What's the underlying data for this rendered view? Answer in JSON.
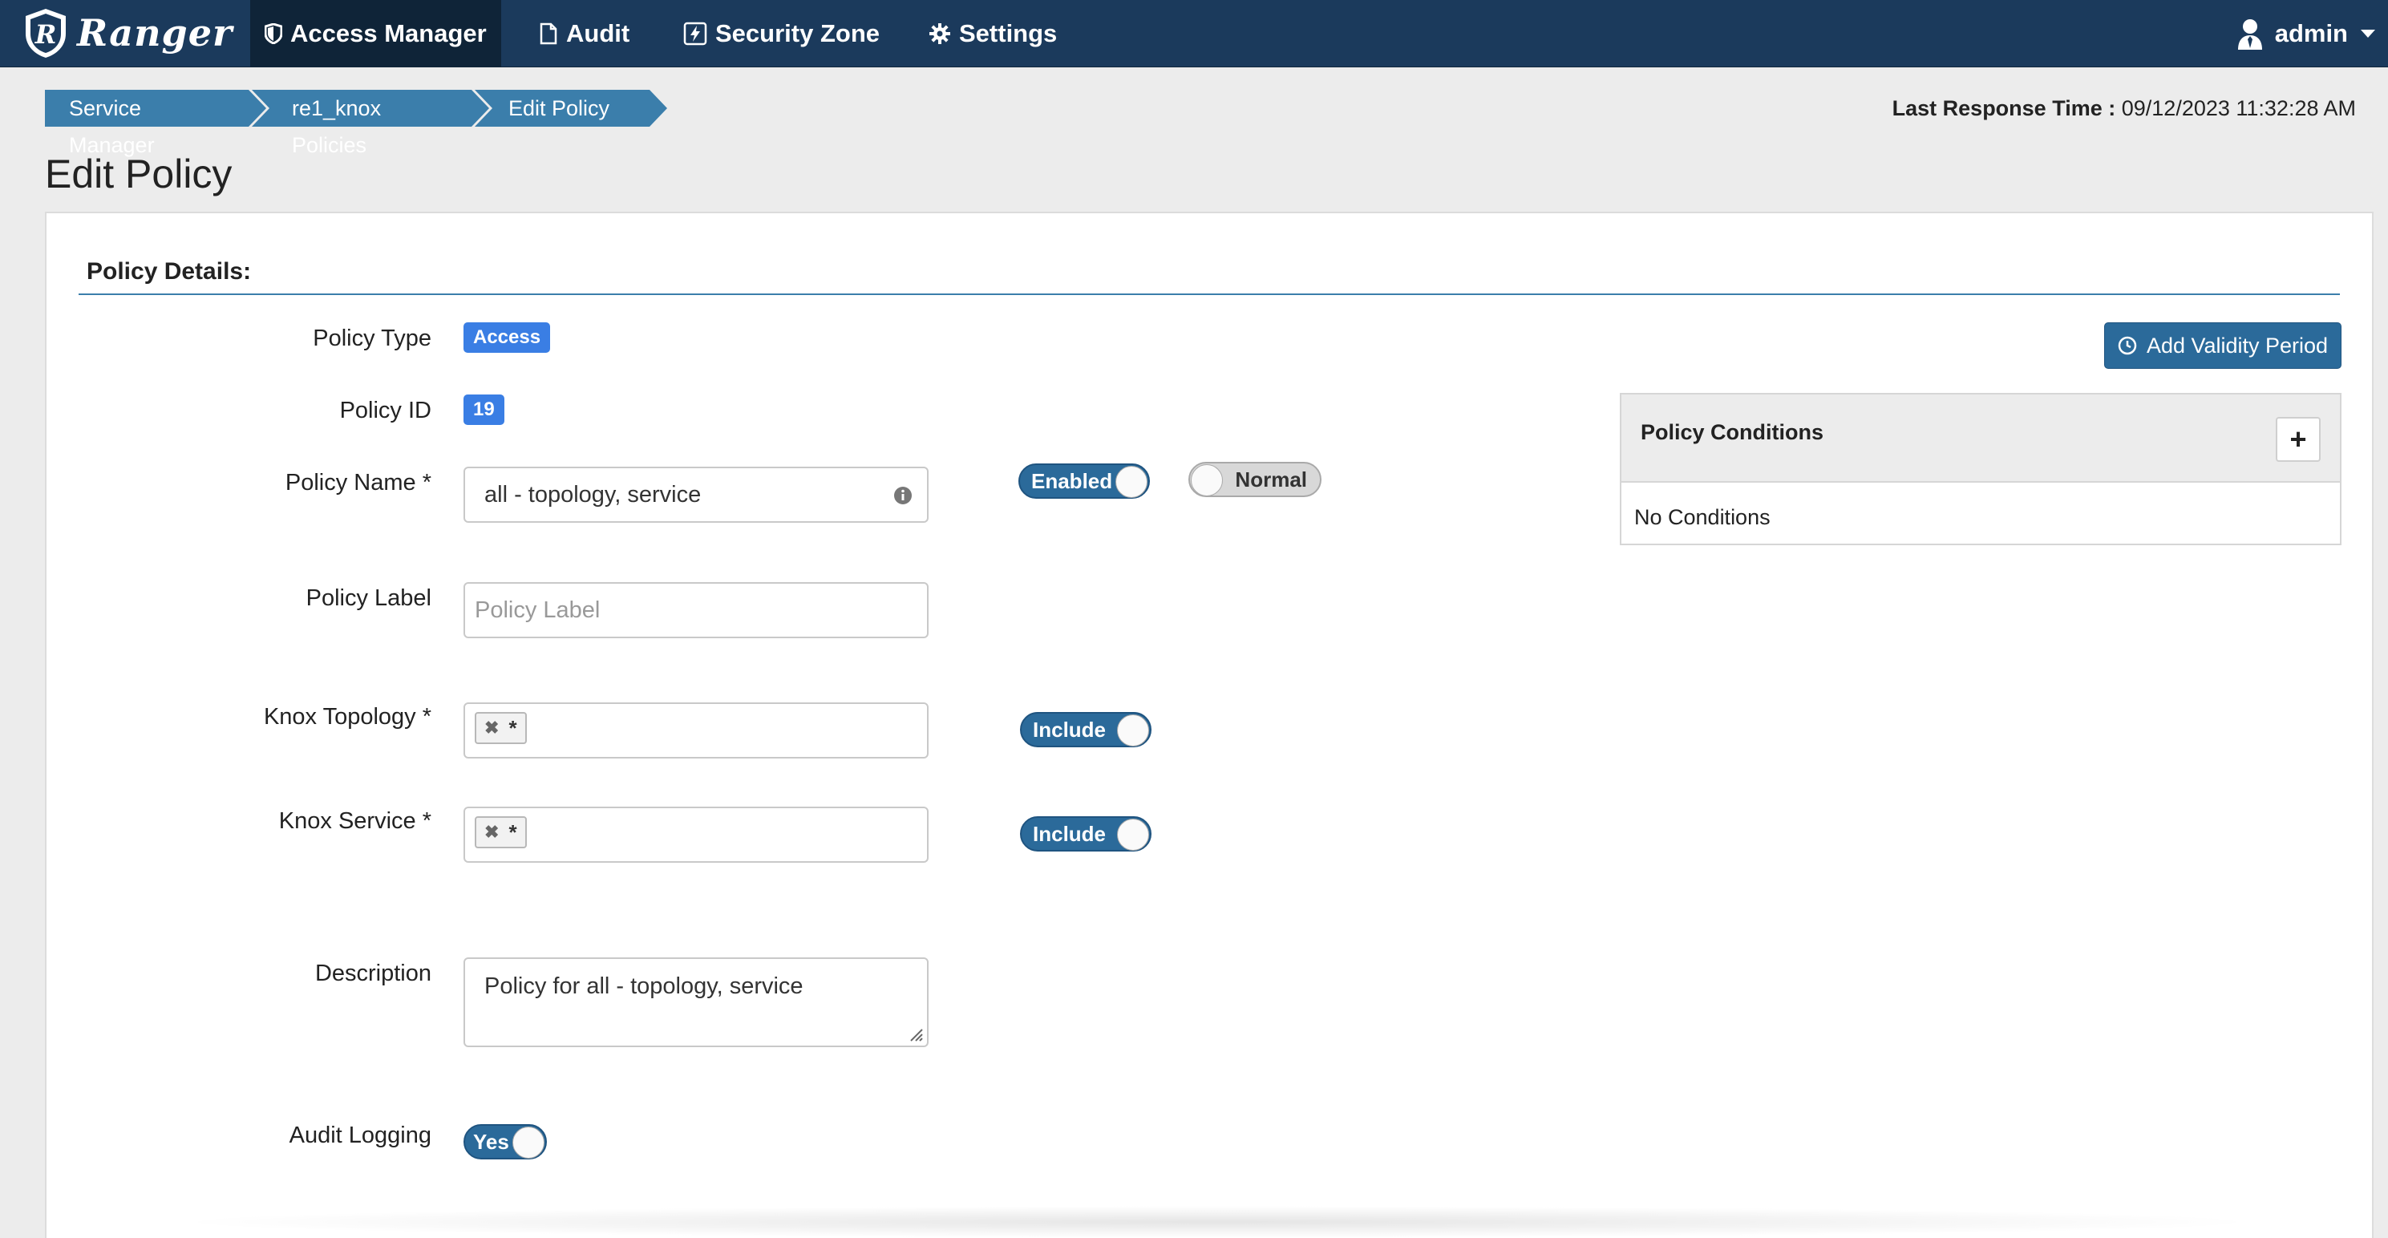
{
  "nav": {
    "brand": "Ranger",
    "items": [
      {
        "label": "Access Manager",
        "icon": "shield-icon"
      },
      {
        "label": "Audit",
        "icon": "file-icon"
      },
      {
        "label": "Security Zone",
        "icon": "bolt-icon"
      },
      {
        "label": "Settings",
        "icon": "gear-icon"
      }
    ],
    "user": "admin"
  },
  "breadcrumb": [
    "Service Manager",
    "re1_knox Policies",
    "Edit Policy"
  ],
  "last_response": {
    "label": "Last Response Time :",
    "value": "09/12/2023 11:32:28 AM"
  },
  "page_title": "Edit Policy",
  "policy_details": {
    "section_title": "Policy Details:",
    "policy_type_label": "Policy Type",
    "policy_type": "Access",
    "policy_id_label": "Policy ID",
    "policy_id": "19",
    "policy_name_label": "Policy Name *",
    "policy_name": "all - topology, service",
    "enabled_toggle": "Enabled",
    "priority_toggle": "Normal",
    "policy_label_label": "Policy Label",
    "policy_label_placeholder": "Policy Label",
    "knox_topology_label": "Knox Topology *",
    "knox_topology_tag": "*",
    "knox_topology_toggle": "Include",
    "knox_service_label": "Knox Service *",
    "knox_service_tag": "*",
    "knox_service_toggle": "Include",
    "description_label": "Description",
    "description": "Policy for all - topology, service",
    "audit_logging_label": "Audit Logging",
    "audit_logging_toggle": "Yes"
  },
  "validity_button": "Add Validity Period",
  "policy_conditions": {
    "title": "Policy Conditions",
    "add": "+",
    "empty": "No Conditions"
  },
  "colors": {
    "navbar": "#1b3a5c",
    "accent": "#2b6a9a",
    "breadcrumb": "#3b7eab",
    "badge": "#3a7ee4"
  }
}
